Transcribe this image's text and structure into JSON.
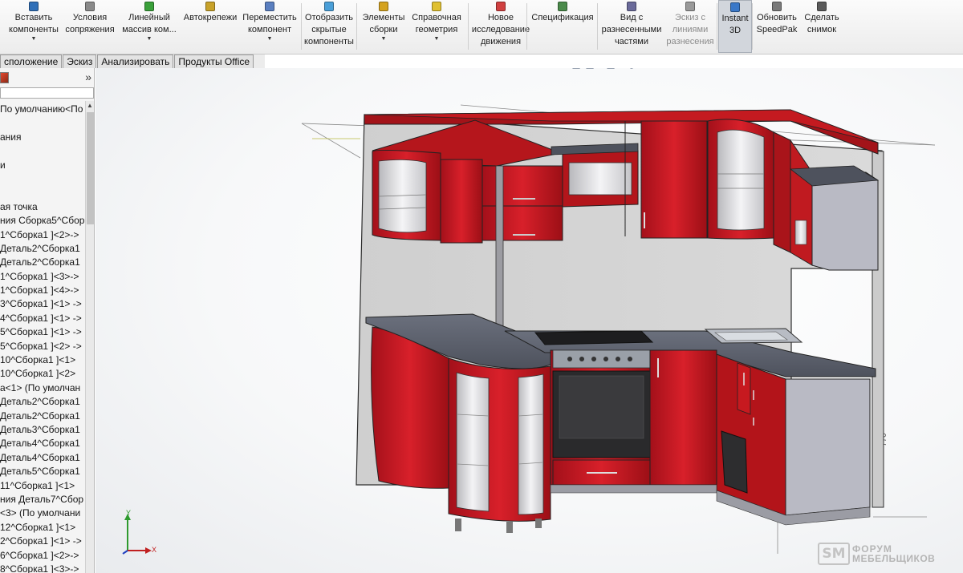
{
  "ribbon": {
    "buttons": [
      {
        "label": "Вставить\nкомпоненты",
        "icon": "insert-components-icon",
        "color": "#2f6fb8",
        "dropdown": true
      },
      {
        "label": "Условия\nсопряжения",
        "icon": "mate-icon",
        "color": "#8a8a8a",
        "dropdown": false
      },
      {
        "label": "Линейный\nмассив ком...",
        "icon": "linear-pattern-icon",
        "color": "#3aa03a",
        "dropdown": true
      },
      {
        "label": "Автокрепежи",
        "icon": "smart-fasteners-icon",
        "color": "#c8a22a",
        "dropdown": false
      },
      {
        "label": "Переместить\nкомпонент",
        "icon": "move-component-icon",
        "color": "#5a7fc0",
        "dropdown": true
      },
      {
        "label": "Отобразить\nскрытые\nкомпоненты",
        "icon": "show-hidden-icon",
        "color": "#4a9fd8",
        "dropdown": false
      },
      {
        "label": "Элементы\nсборки",
        "icon": "assembly-features-icon",
        "color": "#d4a21f",
        "dropdown": true
      },
      {
        "label": "Справочная\nгеометрия",
        "icon": "reference-geometry-icon",
        "color": "#e0c030",
        "dropdown": true
      },
      {
        "label": "Новое\nисследование\nдвижения",
        "icon": "motion-study-icon",
        "color": "#d04040",
        "dropdown": false
      },
      {
        "label": "Спецификация",
        "icon": "bom-icon",
        "color": "#4a8a4a",
        "dropdown": false
      },
      {
        "label": "Вид с\nразнесенными\nчастями",
        "icon": "exploded-view-icon",
        "color": "#6a6a9a",
        "dropdown": false
      },
      {
        "label": "Эскиз с\nлиниями\nразнесения",
        "icon": "explode-line-sketch-icon",
        "color": "#9a9a9a",
        "dropdown": false
      },
      {
        "label": "Instant\n3D",
        "icon": "instant3d-icon",
        "color": "#3a78c8",
        "dropdown": false
      },
      {
        "label": "Обновить\nSpeedPak",
        "icon": "speedpak-icon",
        "color": "#7a7a7a",
        "dropdown": false
      },
      {
        "label": "Сделать\nснимок",
        "icon": "snapshot-icon",
        "color": "#5a5a5a",
        "dropdown": false
      }
    ]
  },
  "tabs": [
    "сположение",
    "Эскиз",
    "Анализировать",
    "Продукты Office"
  ],
  "hud": [
    "zoom-to-fit-icon",
    "zoom-area-icon",
    "previous-view-icon",
    "section-view-icon",
    "view-orientation-icon",
    "display-style-icon",
    "hide-show-icon",
    "appearance-icon",
    "scene-icon",
    "view-settings-icon"
  ],
  "panel": {
    "collapse_glyph": "»",
    "tree": [
      "По умолчанию<По",
      "",
      "ания",
      "",
      "и",
      "",
      "",
      "ая точка",
      "ния Сборка5^Сбор",
      "1^Сборка1 ]<2>->",
      "Деталь2^Сборка1",
      "Деталь2^Сборка1",
      "1^Сборка1 ]<3>->",
      "1^Сборка1 ]<4>->",
      "3^Сборка1 ]<1> ->",
      "4^Сборка1 ]<1> ->",
      "5^Сборка1 ]<1> ->",
      "5^Сборка1 ]<2> ->",
      "10^Сборка1 ]<1>",
      "10^Сборка1 ]<2>",
      "a<1> (По умолчан",
      "Деталь2^Сборка1",
      "Деталь2^Сборка1",
      "Деталь3^Сборка1",
      "Деталь4^Сборка1",
      "Деталь4^Сборка1",
      "Деталь5^Сборка1",
      "11^Сборка1 ]<1>",
      "ния Деталь7^Сбор",
      "<3> (По умолчани",
      "12^Сборка1 ]<1>",
      "2^Сборка1 ]<1> ->",
      "6^Сборка1 ]<2>->",
      "8^Сборка1 ]<3>->"
    ]
  },
  "viewport": {
    "dimension_label": "770",
    "triad": {
      "x": "X",
      "y": "Y"
    },
    "colors": {
      "carcass": "#c8171b",
      "carcass_dark": "#8e0f12",
      "countertop": "#5d6270",
      "side_panel": "#b9bac4",
      "wall": "#d9d9d9"
    }
  },
  "watermark": {
    "logo": "SM",
    "line1": "ФОРУМ",
    "line2": "МЕБЕЛЬЩИКОВ"
  }
}
